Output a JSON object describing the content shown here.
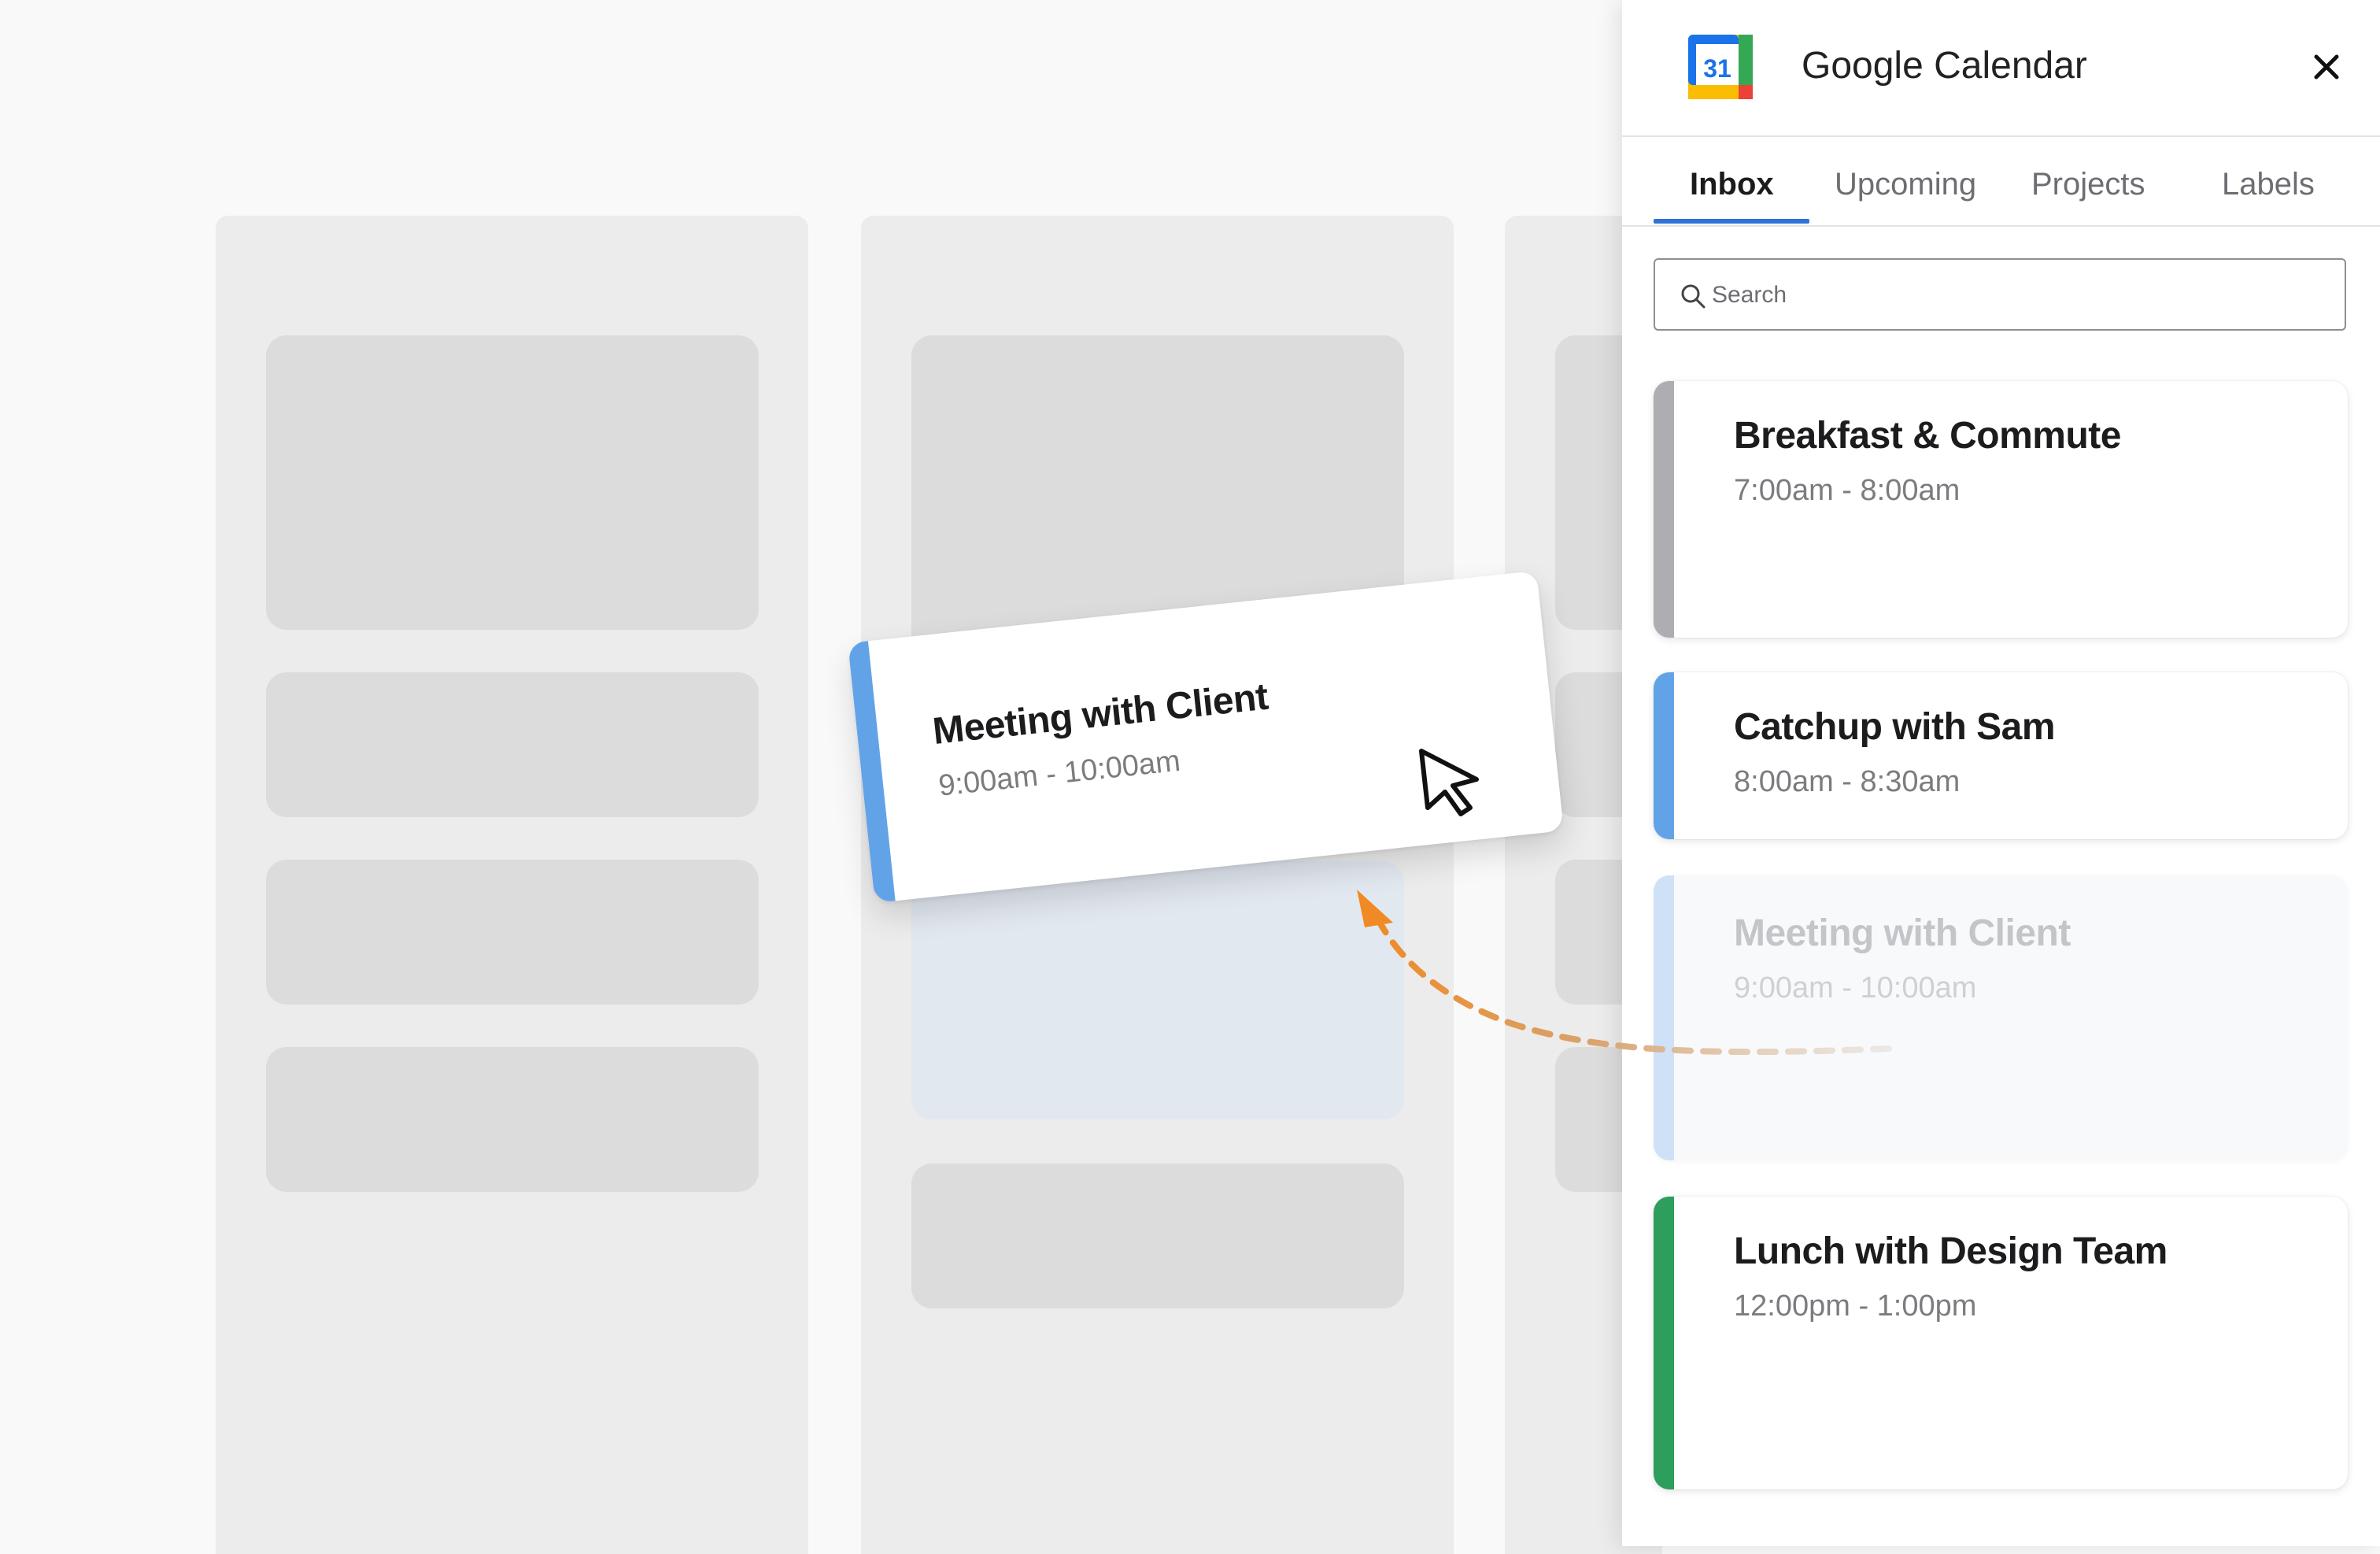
{
  "panel": {
    "title": "Google Calendar",
    "logo_text": "31",
    "tabs": [
      {
        "label": "Inbox",
        "active": true
      },
      {
        "label": "Upcoming",
        "active": false
      },
      {
        "label": "Projects",
        "active": false
      },
      {
        "label": "Labels",
        "active": false
      }
    ],
    "search": {
      "placeholder": "Search"
    },
    "events": [
      {
        "title": "Breakfast & Commute",
        "time": "7:00am - 8:00am",
        "color": "#aeaeb2"
      },
      {
        "title": "Catchup with Sam",
        "time": "8:00am - 8:30am",
        "color": "#62a3e8"
      },
      {
        "title": "Meeting with Client",
        "time": "9:00am - 10:00am",
        "color": "#cfe1f7",
        "state": "dragging-placeholder"
      },
      {
        "title": "Lunch with Design Team",
        "time": "12:00pm - 1:00pm",
        "color": "#2d9e5c"
      }
    ]
  },
  "dragged_card": {
    "title": "Meeting with Client",
    "time": "9:00am - 10:00am",
    "color": "#62a3e8"
  },
  "colors": {
    "accent": "#2f73d6",
    "drag_arrow": "#f08a24"
  },
  "icons": {
    "logo": "google-calendar-logo",
    "close": "close-icon",
    "search": "search-icon",
    "cursor": "mouse-pointer-icon",
    "arrow": "dashed-arrow-icon"
  }
}
